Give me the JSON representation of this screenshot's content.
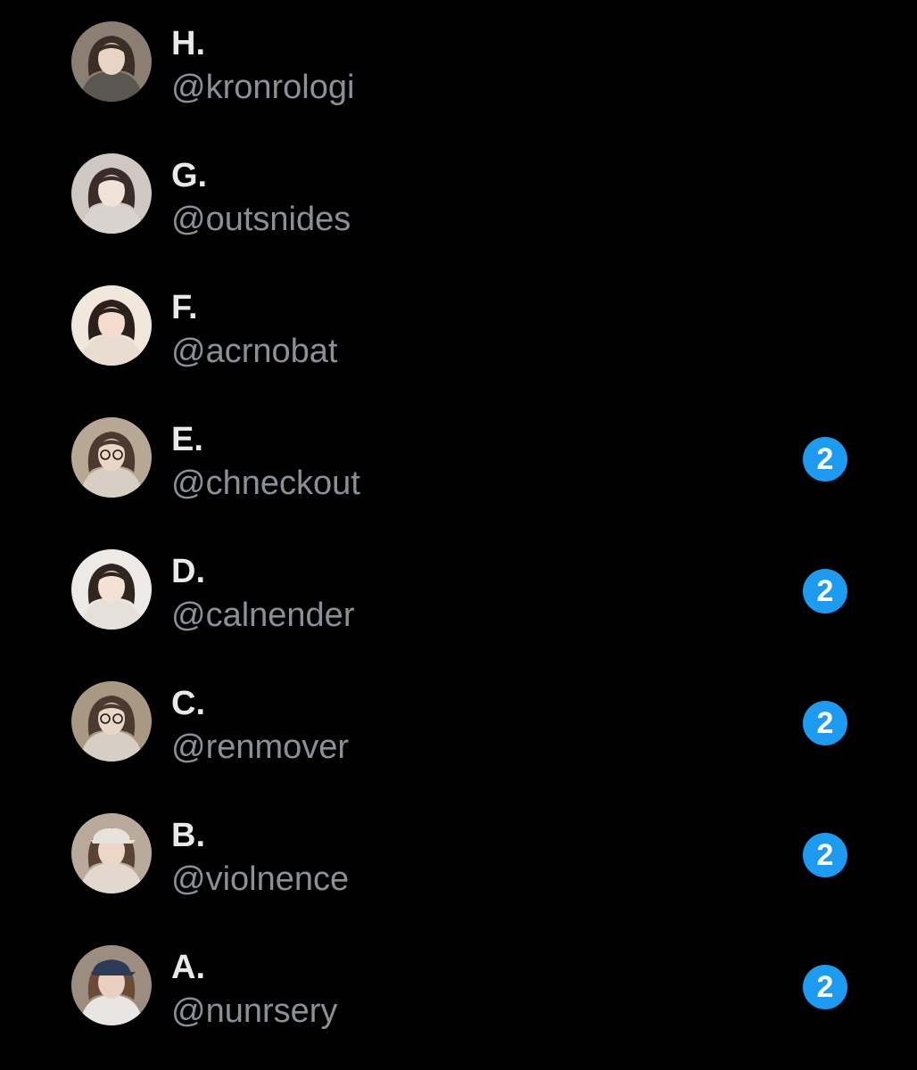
{
  "conversations": [
    {
      "name": "H.",
      "handle": "@kronrologi",
      "unread": null,
      "avatar": {
        "bg": "#8a7f72",
        "skin": "#e8d3c4",
        "hair": "#3b2e27",
        "top": "#5a5650",
        "glasses": false,
        "cap": false
      }
    },
    {
      "name": "G.",
      "handle": "@outsnides",
      "unread": null,
      "avatar": {
        "bg": "#cfc7c2",
        "skin": "#f1e2da",
        "hair": "#3a2c28",
        "top": "#d9d3cf",
        "glasses": false,
        "cap": false
      }
    },
    {
      "name": "F.",
      "handle": "@acrnobat",
      "unread": null,
      "avatar": {
        "bg": "#f2e7dc",
        "skin": "#f4dccd",
        "hair": "#2b211c",
        "top": "#e9ddd1",
        "glasses": false,
        "cap": false
      }
    },
    {
      "name": "E.",
      "handle": "@chneckout",
      "unread": "2",
      "avatar": {
        "bg": "#b7a896",
        "skin": "#ead6c6",
        "hair": "#4a3a30",
        "top": "#d8cfc4",
        "glasses": true,
        "cap": false
      }
    },
    {
      "name": "D.",
      "handle": "@calnender",
      "unread": "2",
      "avatar": {
        "bg": "#ece9e6",
        "skin": "#f3e1d6",
        "hair": "#2f2521",
        "top": "#e6e0db",
        "glasses": false,
        "cap": false
      }
    },
    {
      "name": "C.",
      "handle": "@renmover",
      "unread": "2",
      "avatar": {
        "bg": "#a99883",
        "skin": "#ead6c6",
        "hair": "#4a3a30",
        "top": "#d8cfc4",
        "glasses": true,
        "cap": false
      }
    },
    {
      "name": "B.",
      "handle": "@violnence",
      "unread": "2",
      "avatar": {
        "bg": "#b9aa9b",
        "skin": "#ecd6c8",
        "hair": "#5a4234",
        "top": "#e3d8cd",
        "glasses": false,
        "cap": true,
        "cap_color": "#e7e2dc"
      }
    },
    {
      "name": "A.",
      "handle": "@nunrsery",
      "unread": "2",
      "avatar": {
        "bg": "#9b8e80",
        "skin": "#e9cfc0",
        "hair": "#6b4a36",
        "top": "#e8e6e2",
        "glasses": false,
        "cap": true,
        "cap_color": "#2c3a55"
      }
    }
  ]
}
